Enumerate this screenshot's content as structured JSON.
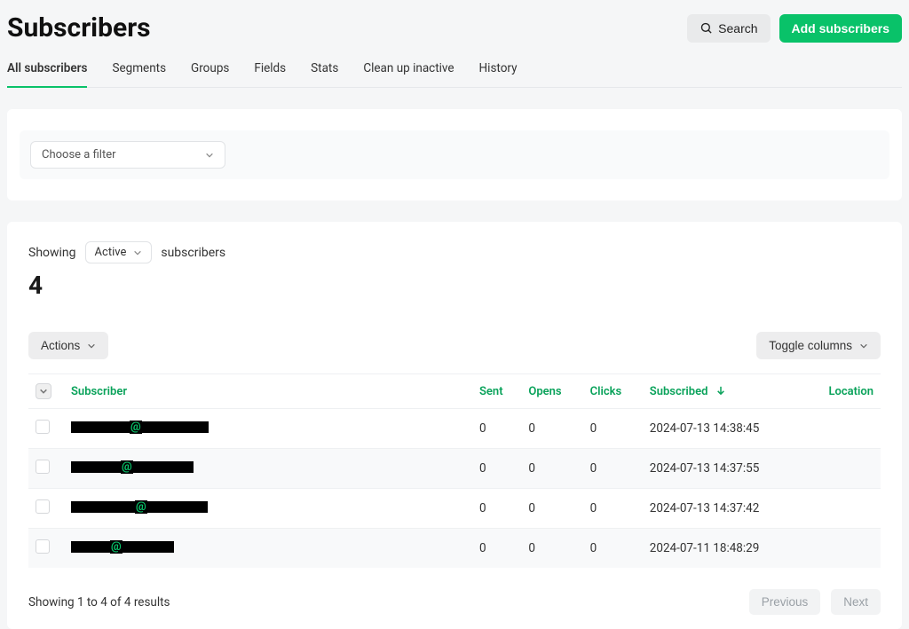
{
  "header": {
    "title": "Subscribers",
    "search_label": "Search",
    "add_label": "Add subscribers"
  },
  "tabs": [
    {
      "label": "All subscribers",
      "active": true
    },
    {
      "label": "Segments",
      "active": false
    },
    {
      "label": "Groups",
      "active": false
    },
    {
      "label": "Fields",
      "active": false
    },
    {
      "label": "Stats",
      "active": false
    },
    {
      "label": "Clean up inactive",
      "active": false
    },
    {
      "label": "History",
      "active": false
    }
  ],
  "filter": {
    "placeholder": "Choose a filter"
  },
  "showing": {
    "prefix": "Showing",
    "status": "Active",
    "suffix": "subscribers",
    "count": "4"
  },
  "toolbar": {
    "actions_label": "Actions",
    "toggle_label": "Toggle columns"
  },
  "columns": {
    "subscriber": "Subscriber",
    "sent": "Sent",
    "opens": "Opens",
    "clicks": "Clicks",
    "subscribed": "Subscribed",
    "location": "Location"
  },
  "rows": [
    {
      "sent": "0",
      "opens": "0",
      "clicks": "0",
      "subscribed": "2024-07-13 14:38:45",
      "location": "",
      "bar1": 66,
      "bar2": 75,
      "at": "@"
    },
    {
      "sent": "0",
      "opens": "0",
      "clicks": "0",
      "subscribed": "2024-07-13 14:37:55",
      "location": "",
      "bar1": 56,
      "bar2": 68,
      "at": "@"
    },
    {
      "sent": "0",
      "opens": "0",
      "clicks": "0",
      "subscribed": "2024-07-13 14:37:42",
      "location": "",
      "bar1": 72,
      "bar2": 68,
      "at": "@"
    },
    {
      "sent": "0",
      "opens": "0",
      "clicks": "0",
      "subscribed": "2024-07-11 18:48:29",
      "location": "",
      "bar1": 44,
      "bar2": 58,
      "at": "@"
    }
  ],
  "footer": {
    "results_text": "Showing 1 to 4 of 4 results",
    "prev_label": "Previous",
    "next_label": "Next"
  }
}
